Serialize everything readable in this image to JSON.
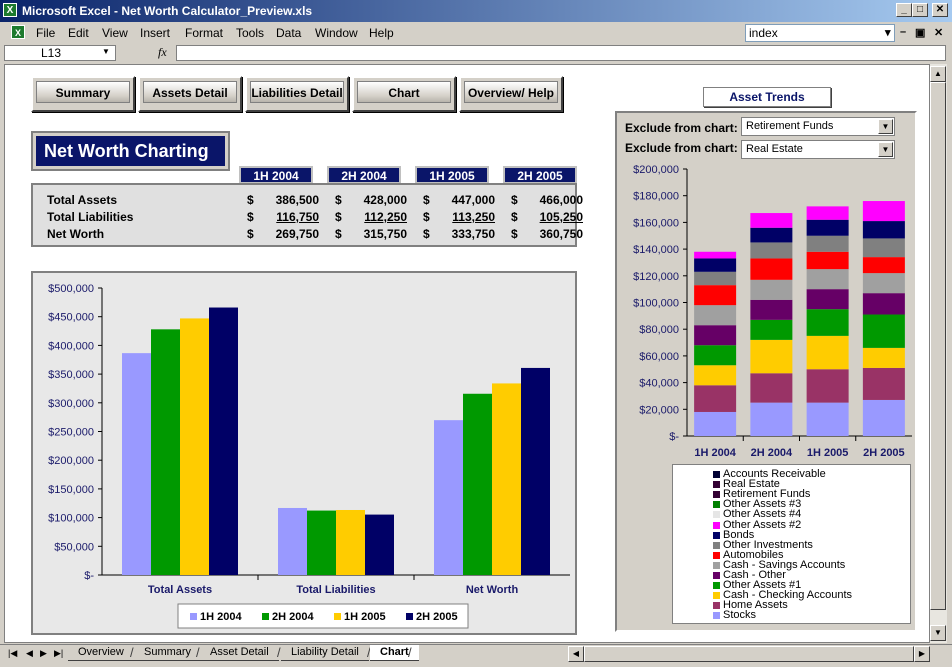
{
  "window": {
    "title": "Microsoft Excel - Net Worth Calculator_Preview.xls",
    "app_icon": "X"
  },
  "menu": [
    "File",
    "Edit",
    "View",
    "Insert",
    "Format",
    "Tools",
    "Data",
    "Window",
    "Help"
  ],
  "help_box": {
    "value": "index"
  },
  "formula_bar": {
    "cell_ref": "L13",
    "fx": "fx",
    "value": ""
  },
  "nav_buttons": [
    "Summary",
    "Assets Detail",
    "Liabilities Detail",
    "Chart",
    "Overview/ Help"
  ],
  "heading": "Net Worth Charting",
  "periods": [
    "1H 2004",
    "2H 2004",
    "1H 2005",
    "2H 2005"
  ],
  "totals": {
    "currency": "$",
    "rows": [
      {
        "label": "Total Assets",
        "values": [
          "386,500",
          "428,000",
          "447,000",
          "466,000"
        ]
      },
      {
        "label": "Total Liabilities",
        "values": [
          "116,750",
          "112,250",
          "113,250",
          "105,250"
        ]
      },
      {
        "label": "Net Worth",
        "values": [
          "269,750",
          "315,750",
          "333,750",
          "360,750"
        ]
      }
    ]
  },
  "trend_title": "Asset Trends",
  "exclude": {
    "label": "Exclude from chart:",
    "selected_1": "Retirement Funds",
    "selected_2": "Real Estate"
  },
  "colors": {
    "1H 2004": "#9999ff",
    "2H 2004": "#009900",
    "1H 2005": "#ffcc00",
    "2H 2005": "#000066"
  },
  "chart_data": [
    {
      "type": "bar",
      "categories": [
        "Total Assets",
        "Total Liabilities",
        "Net Worth"
      ],
      "series": [
        {
          "name": "1H 2004",
          "values": [
            386500,
            116750,
            269750
          ]
        },
        {
          "name": "2H 2004",
          "values": [
            428000,
            112250,
            315750
          ]
        },
        {
          "name": "1H 2005",
          "values": [
            447000,
            113250,
            333750
          ]
        },
        {
          "name": "2H 2005",
          "values": [
            466000,
            105250,
            360750
          ]
        }
      ],
      "ylim": [
        0,
        500000
      ],
      "yticks": [
        "$-",
        "$50,000",
        "$100,000",
        "$150,000",
        "$200,000",
        "$250,000",
        "$300,000",
        "$350,000",
        "$400,000",
        "$450,000",
        "$500,000"
      ],
      "legend": "bottom",
      "grid": false
    },
    {
      "type": "bar",
      "stacked": true,
      "title": "Asset Trends",
      "categories": [
        "1H 2004",
        "2H 2004",
        "1H 2005",
        "2H 2005"
      ],
      "ylim": [
        0,
        200000
      ],
      "yticks": [
        "$-",
        "$20,000",
        "$40,000",
        "$60,000",
        "$80,000",
        "$100,000",
        "$120,000",
        "$140,000",
        "$160,000",
        "$180,000",
        "$200,000"
      ],
      "legend": "bottom",
      "series": [
        {
          "name": "Stocks",
          "color": "#9999ff",
          "values": [
            18000,
            25000,
            25000,
            27000
          ]
        },
        {
          "name": "Home Assets",
          "color": "#993366",
          "values": [
            20000,
            22000,
            25000,
            24000
          ]
        },
        {
          "name": "Cash - Checking Accounts",
          "color": "#ffcc00",
          "values": [
            15000,
            25000,
            25000,
            15000
          ]
        },
        {
          "name": "Other Assets #1",
          "color": "#009900",
          "values": [
            15000,
            15000,
            20000,
            25000
          ]
        },
        {
          "name": "Cash - Other",
          "color": "#660066",
          "values": [
            15000,
            15000,
            15000,
            16000
          ]
        },
        {
          "name": "Cash - Savings Accounts",
          "color": "#a0a0a0",
          "values": [
            15000,
            15000,
            15000,
            15000
          ]
        },
        {
          "name": "Automobiles",
          "color": "#ff0000",
          "values": [
            15000,
            16000,
            13000,
            12000
          ]
        },
        {
          "name": "Other Investments",
          "color": "#808080",
          "values": [
            10000,
            12000,
            12000,
            14000
          ]
        },
        {
          "name": "Bonds",
          "color": "#000066",
          "values": [
            10000,
            11000,
            12000,
            13000
          ]
        },
        {
          "name": "Other Assets #2",
          "color": "#ff00ff",
          "values": [
            5000,
            11000,
            10000,
            15000
          ]
        },
        {
          "name": "Other Assets #4",
          "color": "#e6e6e6",
          "values": [
            0,
            0,
            0,
            0
          ]
        },
        {
          "name": "Other Assets #3",
          "color": "#008000",
          "values": [
            0,
            0,
            0,
            0
          ]
        },
        {
          "name": "Retirement Funds",
          "color": "#330033",
          "values": [
            0,
            0,
            0,
            0
          ]
        },
        {
          "name": "Real Estate",
          "color": "#330033",
          "values": [
            0,
            0,
            0,
            0
          ]
        },
        {
          "name": "Accounts Receivable",
          "color": "#000033",
          "values": [
            0,
            0,
            0,
            0
          ]
        }
      ]
    }
  ],
  "sheet_tabs": [
    "Overview",
    "Summary",
    "Asset Detail",
    "Liability Detail",
    "Chart"
  ],
  "active_tab": "Chart"
}
